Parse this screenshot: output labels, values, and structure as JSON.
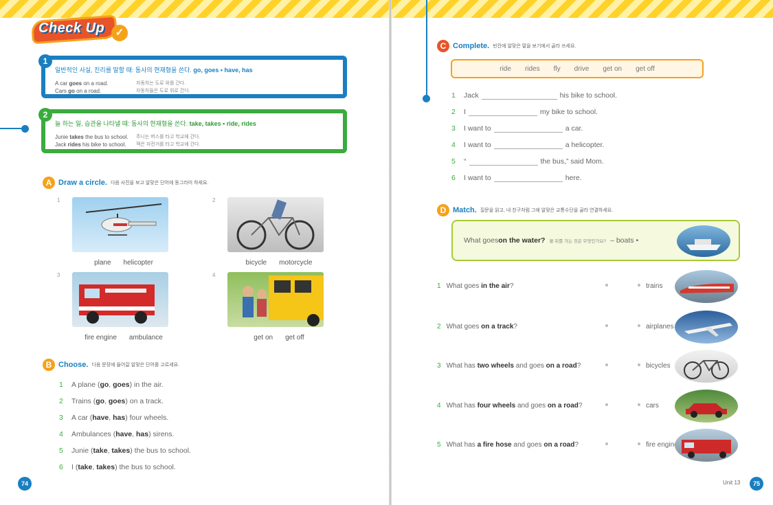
{
  "logo": {
    "text": "Check Up"
  },
  "rules": [
    {
      "num": "1",
      "title": "일반적인 사실, 진리를 말할 때: 동사의 현재형을 쓴다.",
      "bold": "go, goes • have, has",
      "examples": [
        {
          "en_pre": "A car ",
          "en_bold": "goes",
          "en_post": " on a road.",
          "ko": "자동차는 도로 위를 간다."
        },
        {
          "en_pre": "Cars ",
          "en_bold": "go",
          "en_post": " on a road.",
          "ko": "자동차들은 도로 위로 간다."
        }
      ]
    },
    {
      "num": "2",
      "title": "늘 하는 일, 습관을 나타낼 때: 동사의 현재형을 쓴다.",
      "bold": "take, takes • ride, rides",
      "examples": [
        {
          "en_pre": "Junie ",
          "en_bold": "takes",
          "en_post": " the bus to school.",
          "ko": "주니는 버스를 타고 학교에 간다."
        },
        {
          "en_pre": "Jack ",
          "en_bold": "rides",
          "en_post": " his bike to school.",
          "ko": "잭은 자전거를 타고 학교에 간다."
        }
      ]
    }
  ],
  "sectionA": {
    "letter": "A",
    "title": "Draw a circle.",
    "ko": "다음 사진을 보고 알맞은 단어에 동그라미 하세요.",
    "items": [
      {
        "num": "1",
        "opt1": "plane",
        "opt2": "helicopter",
        "img": "helicopter-photo"
      },
      {
        "num": "2",
        "opt1": "bicycle",
        "opt2": "motorcycle",
        "img": "bicycle-photo"
      },
      {
        "num": "3",
        "opt1": "fire engine",
        "opt2": "ambulance",
        "img": "fire-engine-photo"
      },
      {
        "num": "4",
        "opt1": "get on",
        "opt2": "get off",
        "img": "school-bus-photo"
      }
    ]
  },
  "sectionB": {
    "letter": "B",
    "title": "Choose.",
    "ko": "다음 문장에 들어갈 알맞은 단어를 고르세요.",
    "items": [
      {
        "num": "1",
        "pre": "A plane ( ",
        "o1": "go",
        "o2": "goes",
        "post": " ) in the air."
      },
      {
        "num": "2",
        "pre": "Trains ( ",
        "o1": "go",
        "o2": "goes",
        "post": " ) on a track."
      },
      {
        "num": "3",
        "pre": "A car ( ",
        "o1": "have",
        "o2": "has",
        "post": " ) four wheels."
      },
      {
        "num": "4",
        "pre": "Ambulances ( ",
        "o1": "have",
        "o2": "has",
        "post": " ) sirens."
      },
      {
        "num": "5",
        "pre": "Junie ( ",
        "o1": "take",
        "o2": "takes",
        "post": " ) the bus to school."
      },
      {
        "num": "6",
        "pre": "I ( ",
        "o1": "take",
        "o2": "takes",
        "post": " ) the bus to school."
      }
    ]
  },
  "sectionC": {
    "letter": "C",
    "title": "Complete.",
    "ko": "빈칸에 알맞은 말을 보기에서 골라 쓰세요.",
    "words": [
      "ride",
      "rides",
      "fly",
      "drive",
      "get on",
      "get off"
    ],
    "items": [
      {
        "num": "1",
        "pre": "Jack",
        "post": "his bike to school."
      },
      {
        "num": "2",
        "pre": "I",
        "post": "my bike to school."
      },
      {
        "num": "3",
        "pre": "I want to",
        "post": "a car."
      },
      {
        "num": "4",
        "pre": "I want to",
        "post": "a helicopter."
      },
      {
        "num": "5",
        "pre": "“",
        "post": "the bus,” said Mom."
      },
      {
        "num": "6",
        "pre": "I want to",
        "post": "here."
      }
    ]
  },
  "sectionD": {
    "letter": "D",
    "title": "Match.",
    "ko": "질문을 읽고, 내 친구처럼 그에 알맞은 교통수단을 골라 연결하세요.",
    "example": {
      "pre": "What goes ",
      "bold": "on the water?",
      "ko": "물 위를 가는 것은 무엇인가요?",
      "dash": "–",
      "answer": "boats",
      "bullet": "•"
    },
    "items": [
      {
        "num": "1",
        "segments": [
          [
            "What goes ",
            false
          ],
          [
            "in the air",
            true
          ],
          [
            "?",
            false
          ]
        ],
        "answer": "trains"
      },
      {
        "num": "2",
        "segments": [
          [
            "What goes ",
            false
          ],
          [
            "on a track",
            true
          ],
          [
            "?",
            false
          ]
        ],
        "answer": "airplanes"
      },
      {
        "num": "3",
        "segments": [
          [
            "What has ",
            false
          ],
          [
            "two wheels",
            true
          ],
          [
            " and goes ",
            false
          ],
          [
            "on a road",
            true
          ],
          [
            "?",
            false
          ]
        ],
        "answer": "bicycles"
      },
      {
        "num": "4",
        "segments": [
          [
            "What has ",
            false
          ],
          [
            "four wheels",
            true
          ],
          [
            " and goes ",
            false
          ],
          [
            "on a road",
            true
          ],
          [
            "?",
            false
          ]
        ],
        "answer": "cars"
      },
      {
        "num": "5",
        "segments": [
          [
            "What has ",
            false
          ],
          [
            "a fire hose",
            true
          ],
          [
            " and goes ",
            false
          ],
          [
            "on a road",
            true
          ],
          [
            "?",
            false
          ]
        ],
        "answer": "fire engines"
      }
    ]
  },
  "footer": {
    "left_page": "74",
    "right_page": "75",
    "unit": "Unit 13"
  }
}
